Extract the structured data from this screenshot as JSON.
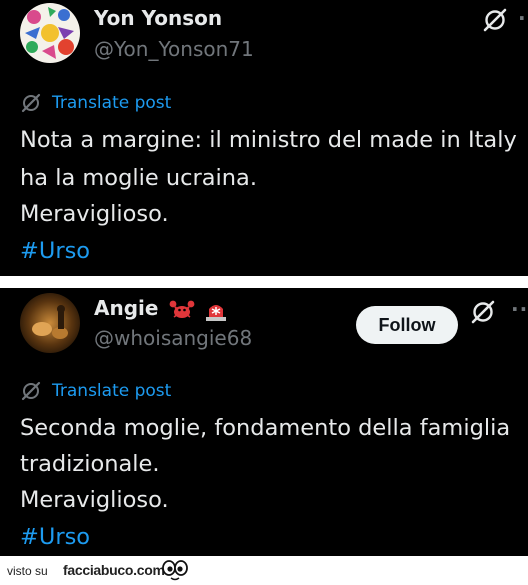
{
  "posts": [
    {
      "author_name": "Yon Yonson",
      "handle": "@Yon_Yonson71",
      "translate_label": "Translate post",
      "lines": [
        "Nota a margine: il ministro del made in Italy",
        "ha la moglie ucraina.",
        "Meraviglioso."
      ],
      "hashtag": "#Urso",
      "more_icon": "more-dots-icon"
    },
    {
      "author_name": "Angie",
      "name_emojis": [
        "crab-emoji",
        "siren-emoji"
      ],
      "handle": "@whoisangie68",
      "follow_label": "Follow",
      "translate_label": "Translate post",
      "lines": [
        "Seconda moglie, fondamento della famiglia",
        "tradizionale.",
        "Meraviglioso."
      ],
      "hashtag": "#Urso",
      "more_icon": "more-dots-icon"
    }
  ],
  "footer": {
    "visto_label": "visto su",
    "brand": "facciabuco.com"
  },
  "colors": {
    "background": "#000000",
    "text": "#e7e9ea",
    "secondary": "#71767b",
    "link": "#1d9bf0"
  }
}
